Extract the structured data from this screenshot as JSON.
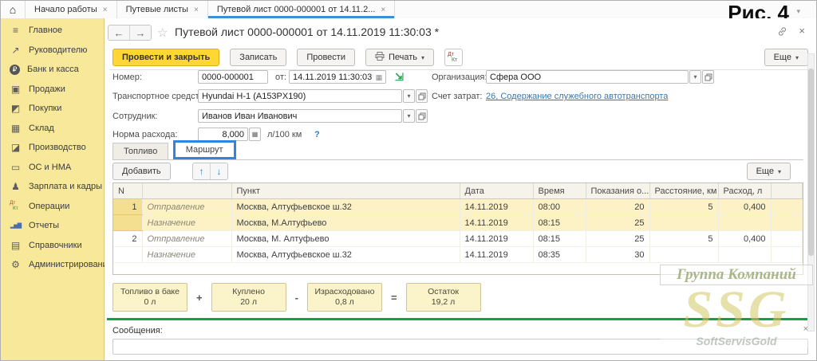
{
  "colors": {
    "accent_yellow": "#ffd633",
    "sidebar_yellow": "#f7e89a",
    "selection_yellow": "#fcf2c5",
    "summary_yellow": "#fbf3c9",
    "link_blue": "#3a77ad",
    "tab_underline_blue": "#3a8fd9",
    "annotation_blue": "#2e86e0",
    "divider_green": "#13a04a"
  },
  "figure_label": "Рис. 4",
  "tab_bar": {
    "home_icon": "⌂",
    "tabs": [
      {
        "label": "Начало работы",
        "close": "×"
      },
      {
        "label": "Путевые листы",
        "close": "×"
      },
      {
        "label": "Путевой лист 0000-000001 от 14.11.2...",
        "close": "×"
      }
    ]
  },
  "sidebar": {
    "items": [
      {
        "icon": "≡",
        "label": "Главное"
      },
      {
        "icon": "↗",
        "label": "Руководителю"
      },
      {
        "icon": "₽",
        "label": "Банк и касса"
      },
      {
        "icon": "▣",
        "label": "Продажи"
      },
      {
        "icon": "◩",
        "label": "Покупки"
      },
      {
        "icon": "▦",
        "label": "Склад"
      },
      {
        "icon": "◪",
        "label": "Производство"
      },
      {
        "icon": "▭",
        "label": "ОС и НМА"
      },
      {
        "icon": "♟",
        "label": "Зарплата и кадры"
      },
      {
        "icon_dt": "Дт",
        "icon_kt": "Кт",
        "label": "Операции"
      },
      {
        "icon": "▂▅▇",
        "label": "Отчеты"
      },
      {
        "icon": "▤",
        "label": "Справочники"
      },
      {
        "icon": "⚙",
        "label": "Администрирование"
      }
    ]
  },
  "document": {
    "nav": {
      "back": "←",
      "forward": "→",
      "star": "☆",
      "close": "×"
    },
    "title": "Путевой лист 0000-000001 от 14.11.2019 11:30:03 *",
    "toolbar": {
      "post_and_close": "Провести и закрыть",
      "save": "Записать",
      "post": "Провести",
      "print": "Печать",
      "caret": "▾",
      "dt": "Дт",
      "kt": "Кт",
      "more": "Еще"
    },
    "fields": {
      "number_label": "Номер:",
      "number_value": "0000-000001",
      "date_label": "от:",
      "date_value": "14.11.2019 11:30:03",
      "calendar_icon": "▦",
      "fill_icon": "⇲",
      "org_label": "Организация:",
      "org_value": "Сфера ООО",
      "vehicle_label": "Транспортное средство:",
      "vehicle_value": "Hyundai H-1 (A153PX190)",
      "account_label": "Счет затрат:",
      "account_link": "26, Содержание служебного автотранспорта",
      "employee_label": "Сотрудник:",
      "employee_value": "Иванов Иван Иванович",
      "rate_label": "Норма расхода:",
      "rate_value": "8,000",
      "calc_icon": "▦",
      "rate_unit": "л/100 км",
      "rate_help": "?",
      "dropdown_caret": "▾"
    },
    "tabs": {
      "fuel": "Топливо",
      "route": "Маршрут"
    },
    "table": {
      "add_button": "Добавить",
      "up_arrow": "↑",
      "down_arrow": "↓",
      "more_button": "Еще",
      "caret": "▾",
      "headers": [
        "N",
        "",
        "Пункт",
        "Дата",
        "Время",
        "Показания о...",
        "Расстояние, км",
        "Расход, л"
      ],
      "rows": [
        {
          "n": "1",
          "type": "Отправление",
          "point": "Москва, Алтуфьевское ш.32",
          "date": "14.11.2019",
          "time": "08:00",
          "odometer": "20",
          "distance": "5",
          "consumption": "0,400"
        },
        {
          "n": "",
          "type": "Назначение",
          "point": "Москва, М.Алтуфьево",
          "date": "14.11.2019",
          "time": "08:15",
          "odometer": "25",
          "distance": "",
          "consumption": ""
        },
        {
          "n": "2",
          "type": "Отправление",
          "point": "Москва, М. Алтуфьево",
          "date": "14.11.2019",
          "time": "08:15",
          "odometer": "25",
          "distance": "5",
          "consumption": "0,400"
        },
        {
          "n": "",
          "type": "Назначение",
          "point": "Москва, Алтуфьевское ш.32",
          "date": "14.11.2019",
          "time": "08:35",
          "odometer": "30",
          "distance": "",
          "consumption": ""
        }
      ]
    },
    "summary": {
      "boxes": [
        {
          "label": "Топливо в баке",
          "value": "0 л"
        },
        {
          "label": "Куплено",
          "value": "20 л"
        },
        {
          "label": "Израсходовано",
          "value": "0,8 л"
        },
        {
          "label": "Остаток",
          "value": "19,2 л"
        }
      ],
      "plus": "+",
      "minus": "-",
      "equals": "="
    },
    "messages": {
      "label": "Сообщения:",
      "close": "×"
    }
  },
  "watermark": {
    "line1": "Группа Компаний",
    "line2": "SSG",
    "line3": "SoftServisGold"
  }
}
